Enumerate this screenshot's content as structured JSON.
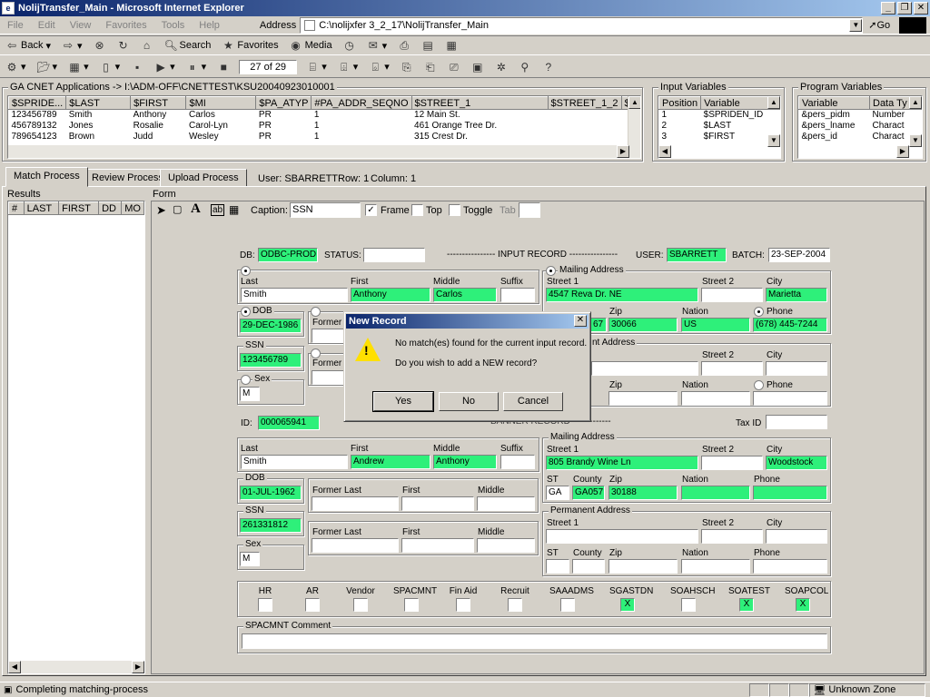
{
  "window": {
    "title": "NolijTransfer_Main - Microsoft Internet Explorer"
  },
  "menu": [
    "File",
    "Edit",
    "View",
    "Favorites",
    "Tools",
    "Help"
  ],
  "address": {
    "label": "Address",
    "value": "C:\\nolijxfer 3_2_17\\NolijTransfer_Main",
    "go": "Go"
  },
  "toolbar": {
    "back": "Back",
    "search": "Search",
    "favorites": "Favorites",
    "media": "Media",
    "page_counter": "27 of 29"
  },
  "applications": {
    "title": "GA CNET Applications -> I:\\ADM-OFF\\CNETTEST\\KSU20040923010001",
    "columns": [
      "$SPRIDE...",
      "$LAST",
      "$FIRST",
      "$MI",
      "$PA_ATYP",
      "#PA_ADDR_SEQNO",
      "$STREET_1",
      "$STREET_1_2",
      "$S"
    ],
    "rows": [
      [
        "123456789",
        "Smith",
        "Anthony",
        "Carlos",
        "PR",
        "1",
        "12 Main St.",
        "",
        ""
      ],
      [
        "456789132",
        "Jones",
        "Rosalie",
        "Carol-Lyn",
        "PR",
        "1",
        "461 Orange Tree Dr.",
        "",
        ""
      ],
      [
        "789654123",
        "Brown",
        "Judd",
        "Wesley",
        "PR",
        "1",
        "315 Crest Dr.",
        "",
        ""
      ]
    ]
  },
  "input_vars": {
    "title": "Input Variables",
    "columns": [
      "Position",
      "Variable"
    ],
    "rows": [
      [
        "1",
        "$SPRIDEN_ID"
      ],
      [
        "2",
        "$LAST"
      ],
      [
        "3",
        "$FIRST"
      ]
    ]
  },
  "program_vars": {
    "title": "Program Variables",
    "columns": [
      "Variable",
      "Data Ty"
    ],
    "rows": [
      [
        "&pers_pidm",
        "Number"
      ],
      [
        "&pers_lname",
        "Charact"
      ],
      [
        "&pers_id",
        "Charact"
      ]
    ]
  },
  "tabs": [
    "Match Process",
    "Review Process",
    "Upload Process"
  ],
  "user_info": {
    "user": "User: SBARRETT",
    "row": "Row: 1",
    "column": "Column: 1"
  },
  "results": {
    "label": "Results",
    "columns": [
      "#",
      "LAST",
      "FIRST",
      "DD",
      "MO"
    ]
  },
  "form": {
    "label": "Form",
    "caption_label": "Caption:",
    "caption_value": "SSN",
    "frame": "Frame",
    "top": "Top",
    "toggle": "Toggle",
    "tab": "Tab"
  },
  "record": {
    "db_label": "DB:",
    "db_value": "ODBC-PROD.",
    "status_label": "STATUS:",
    "input_record": "---------------- INPUT RECORD ----------------",
    "user_label": "USER:",
    "user_value": "SBARRETT",
    "batch_label": "BATCH:",
    "batch_value": "23-SEP-2004",
    "name_labels": [
      "Last",
      "First",
      "Middle",
      "Suffix"
    ],
    "input": {
      "last": "Smith",
      "first": "Anthony",
      "middle": "Carlos",
      "dob_label": "DOB",
      "dob": "29-DEC-1986",
      "former_last": "Former L",
      "ssn_label": "SSN",
      "ssn": "123456789",
      "sex_label": "Sex",
      "sex": "M"
    },
    "mailing": {
      "title": "Mailing Address",
      "street1_label": "Street 1",
      "street2_label": "Street 2",
      "city_label": "City",
      "street1": "4547 Reva Dr. NE",
      "city": "Marietta",
      "st_label": "ST",
      "county_label": "County",
      "zip_label": "Zip",
      "nation_label": "Nation",
      "phone_label": "Phone",
      "county": "67",
      "zip": "30066",
      "nation": "US",
      "phone": "(678) 445-7244"
    },
    "permanent_partial": "nt Address",
    "id_label": "ID:",
    "id_value": "000065941",
    "banner_record": "BANNER RECORD",
    "taxid_label": "Tax ID",
    "banner": {
      "last": "Smith",
      "first": "Andrew",
      "middle": "Anthony",
      "dob": "01-JUL-1962",
      "ssn": "261331812",
      "sex": "M",
      "former_last": "Former Last",
      "first_label": "First",
      "middle_label": "Middle"
    },
    "banner_mailing": {
      "title": "Mailing Address",
      "street1": "805 Brandy Wine Ln",
      "city": "Woodstock",
      "st": "GA",
      "county": "GA057",
      "zip": "30188"
    },
    "permanent": {
      "title": "Permanent Address"
    },
    "flags": [
      {
        "label": "HR",
        "checked": false
      },
      {
        "label": "AR",
        "checked": false
      },
      {
        "label": "Vendor",
        "checked": false
      },
      {
        "label": "SPACMNT",
        "checked": false
      },
      {
        "label": "Fin Aid",
        "checked": false
      },
      {
        "label": "Recruit",
        "checked": false
      },
      {
        "label": "SAAADMS",
        "checked": false
      },
      {
        "label": "SGASTDN",
        "checked": true
      },
      {
        "label": "SOAHSCH",
        "checked": false
      },
      {
        "label": "SOATEST",
        "checked": true
      },
      {
        "label": "SOAPCOL",
        "checked": true
      }
    ],
    "comment_label": "SPACMNT Comment",
    "check_mark": "X"
  },
  "dialog": {
    "title": "New Record",
    "line1": "No match(es) found for the current input record.",
    "line2": "Do you wish to add a NEW record?",
    "yes": "Yes",
    "no": "No",
    "cancel": "Cancel"
  },
  "status": {
    "text": "Completing matching-process",
    "zone": "Unknown Zone"
  },
  "colors": {
    "match_green": "#2ef07a",
    "title_blue": "#0a246a"
  }
}
